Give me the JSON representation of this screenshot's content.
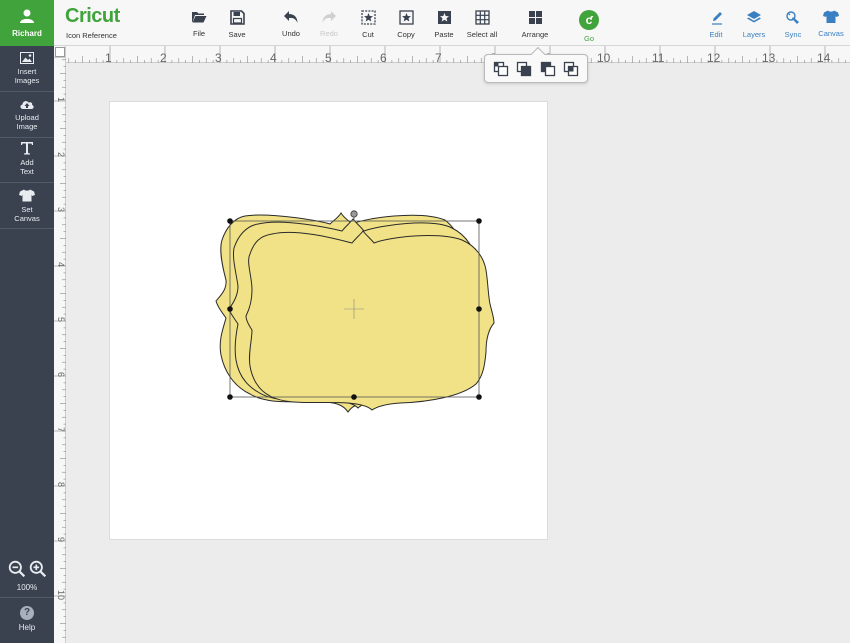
{
  "sidebar": {
    "user_name": "Richard",
    "items": [
      {
        "label_line1": "Insert",
        "label_line2": "Images",
        "icon": "insert-images-icon"
      },
      {
        "label_line1": "Upload",
        "label_line2": "Image",
        "icon": "upload-cloud-icon"
      },
      {
        "label_line1": "Add",
        "label_line2": "Text",
        "icon": "text-icon"
      },
      {
        "label_line1": "Set",
        "label_line2": "Canvas",
        "icon": "shirt-icon"
      }
    ],
    "zoom_value": "100%",
    "help_label": "Help"
  },
  "toolbar": {
    "logo": "Cricut",
    "icon_reference": "Icon Reference",
    "file": "File",
    "save": "Save",
    "undo": "Undo",
    "redo": "Redo",
    "cut": "Cut",
    "copy": "Copy",
    "paste": "Paste",
    "select_all": "Select all",
    "arrange": "Arrange",
    "go": "Go",
    "edit": "Edit",
    "layers": "Layers",
    "sync": "Sync",
    "canvas": "Canvas"
  },
  "ruler": {
    "top": [
      "1",
      "2",
      "3",
      "4",
      "5",
      "6",
      "7",
      "8",
      "9",
      "10",
      "11",
      "12",
      "13",
      "14"
    ],
    "left": [
      "1",
      "2",
      "3",
      "4",
      "5",
      "6",
      "7",
      "8",
      "9",
      "10"
    ]
  },
  "colors": {
    "brand_green": "#41a33c",
    "sidebar_bg": "#3a4250",
    "shape_fill": "#f1e287",
    "accent_blue": "#3a7fc1"
  },
  "arrange_menu": [
    "send-to-back-icon",
    "send-backward-icon",
    "bring-forward-icon",
    "bring-to-front-icon"
  ]
}
